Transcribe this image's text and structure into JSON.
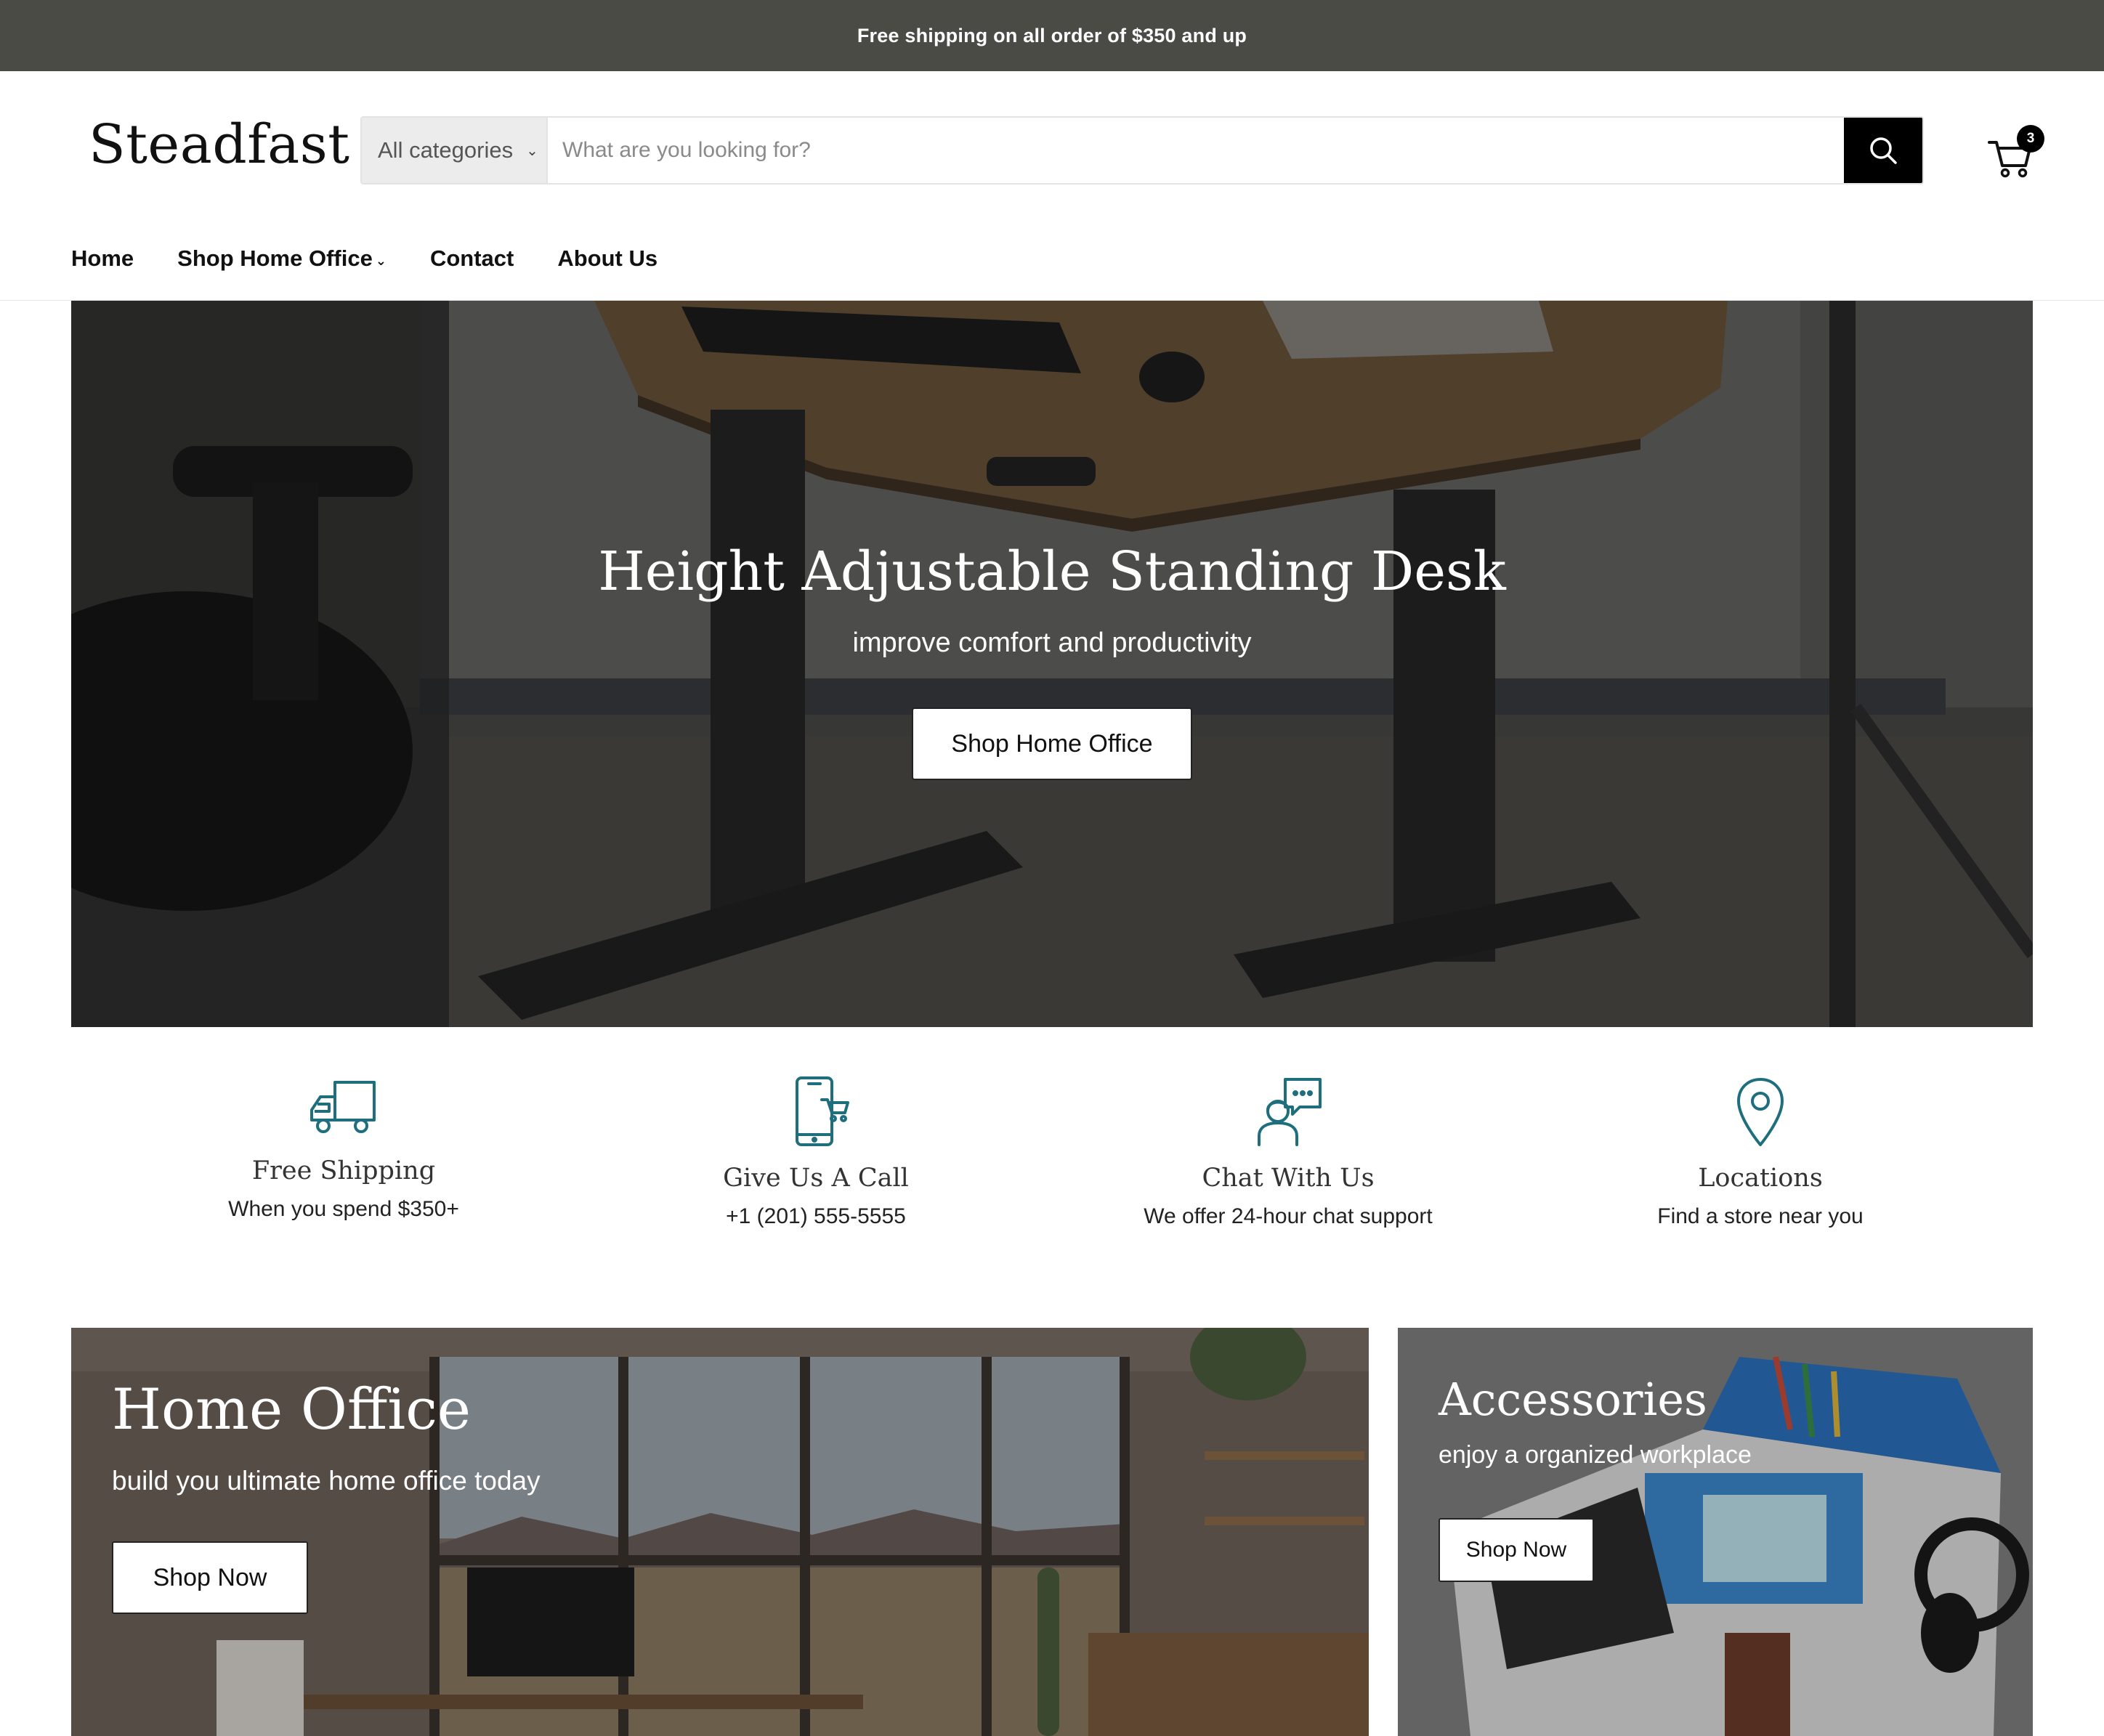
{
  "announcement": "Free shipping on all order of $350 and up",
  "header": {
    "logo": "Steadfast",
    "search": {
      "category": "All categories",
      "placeholder": "What are you looking for?"
    },
    "cart_count": "3"
  },
  "nav": {
    "items": [
      "Home",
      "Shop Home Office",
      "Contact",
      "About Us"
    ]
  },
  "hero": {
    "title": "Height Adjustable Standing Desk",
    "subtitle": "improve comfort and productivity",
    "button": "Shop Home Office"
  },
  "features": [
    {
      "icon": "truck-icon",
      "title": "Free Shipping",
      "text": "When you spend $350+"
    },
    {
      "icon": "phone-cart-icon",
      "title": "Give Us A Call",
      "text": "+1 (201) 555-5555"
    },
    {
      "icon": "chat-support-icon",
      "title": "Chat With Us",
      "text": "We offer 24-hour chat support"
    },
    {
      "icon": "location-pin-icon",
      "title": "Locations",
      "text": "Find a store near you"
    }
  ],
  "promos": {
    "home_office": {
      "title": "Home Office",
      "subtitle": "build you ultimate home office today",
      "button": "Shop Now"
    },
    "accessories": {
      "title": "Accessories",
      "subtitle": "enjoy a organized workplace",
      "button": "Shop Now"
    }
  },
  "colors": {
    "announcement_bg": "#494b44",
    "icon_teal": "#1f6e7e",
    "button_black": "#000000"
  }
}
